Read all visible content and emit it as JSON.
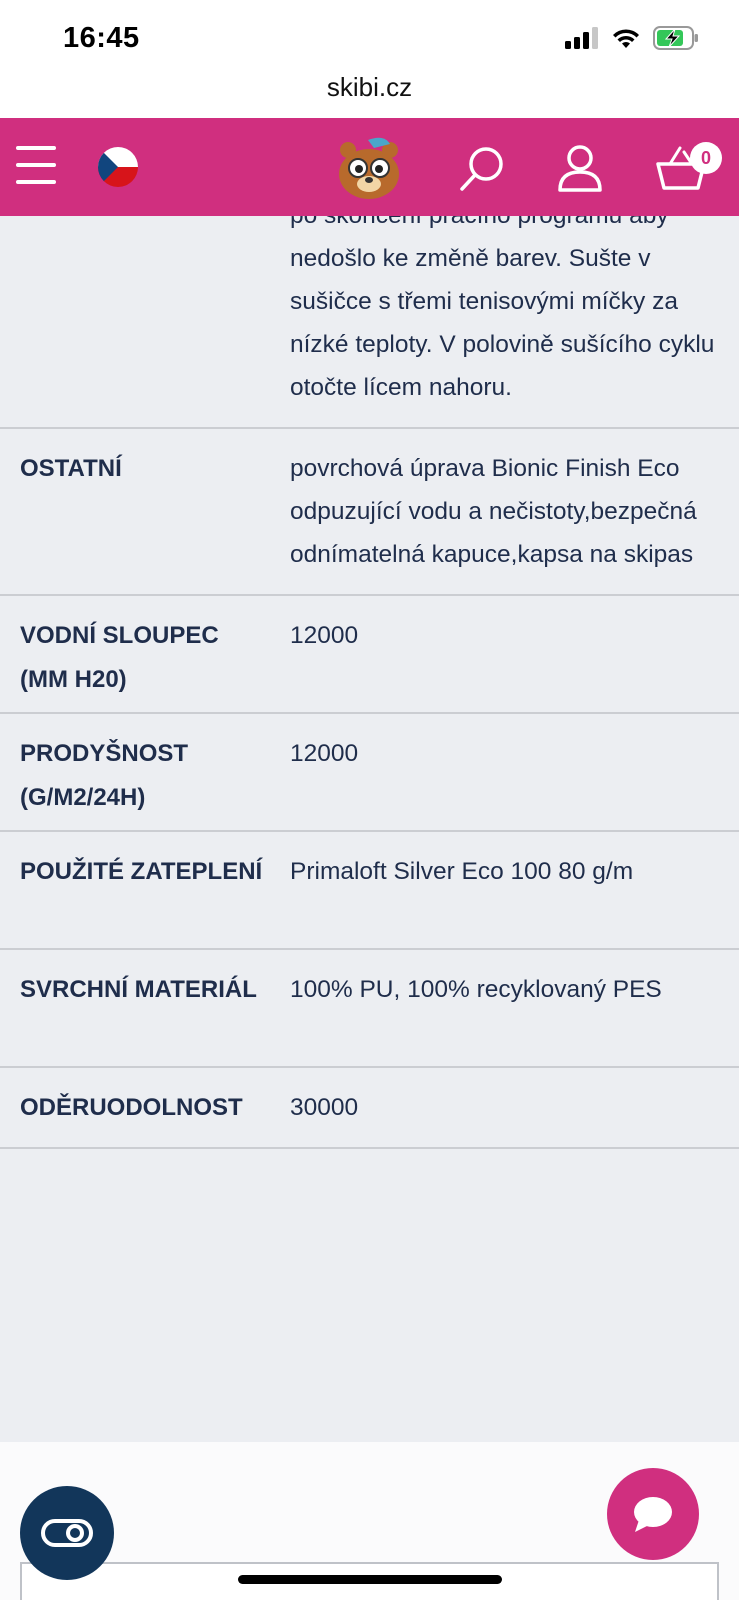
{
  "status_bar": {
    "time": "16:45"
  },
  "browser": {
    "url": "skibi.cz"
  },
  "header": {
    "cart_count": "0",
    "colors": {
      "brand": "#d02f7f",
      "text": "#1f2d4b"
    }
  },
  "specs": {
    "rows": [
      {
        "label": "",
        "value": "po skončení pracího programu aby nedošlo ke změně barev. Sušte v sušičce s třemi tenisovými míčky za nízké teploty. V polovině sušícího cyklu otočte lícem nahoru."
      },
      {
        "label": "OSTATNÍ",
        "value": "povrchová úprava Bionic Finish Eco odpuzující vodu a nečistoty,bezpečná odnímatelná kapuce,kapsa na skipas"
      },
      {
        "label": "VODNÍ SLOUPEC (MM H20)",
        "value": "12000"
      },
      {
        "label": "PRODYŠNOST (G/M2/24H)",
        "value": "12000"
      },
      {
        "label": "POUŽITÉ ZATEPLENÍ",
        "value": "Primaloft Silver Eco 100 80 g/m"
      },
      {
        "label": "SVRCHNÍ MATERIÁL",
        "value": "100% PU, 100% recyklovaný PES"
      },
      {
        "label": "ODĚRUODOLNOST",
        "value": "30000"
      }
    ]
  },
  "icons": {
    "menu": "hamburger-menu-icon",
    "flag": "czech-flag-icon",
    "logo": "bear-mascot-logo",
    "search": "search-icon",
    "account": "user-icon",
    "cart": "basket-icon",
    "accessibility": "accessibility-toggle-icon",
    "chat": "chat-bubble-icon"
  }
}
